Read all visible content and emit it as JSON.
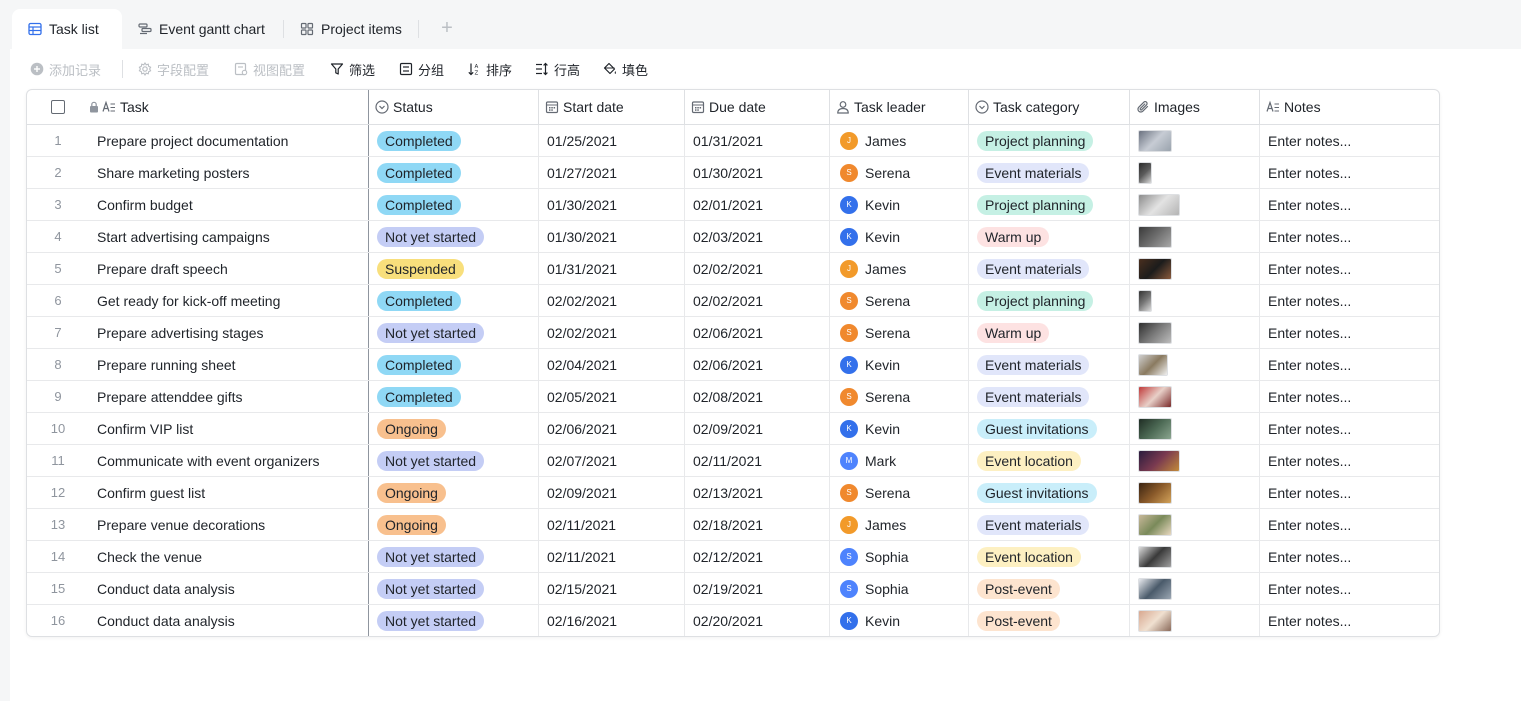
{
  "tabs": [
    {
      "label": "Task list",
      "icon": "table-icon",
      "active": true
    },
    {
      "label": "Event gantt chart",
      "icon": "gantt-icon",
      "active": false
    },
    {
      "label": "Project items",
      "icon": "grid-icon",
      "active": false
    }
  ],
  "add_tab_symbol": "+",
  "toolbar": {
    "add_record": "添加记录",
    "field_config": "字段配置",
    "view_config": "视图配置",
    "filter": "筛选",
    "group": "分组",
    "sort": "排序",
    "row_height": "行高",
    "fill": "填色"
  },
  "columns": {
    "task": "Task",
    "status": "Status",
    "start_date": "Start date",
    "due_date": "Due date",
    "task_leader": "Task leader",
    "task_category": "Task category",
    "images": "Images",
    "notes": "Notes"
  },
  "colors": {
    "status": {
      "Completed": "#8fd8f5",
      "Not yet started": "#c4cdf5",
      "Suspended": "#f8df7c",
      "Ongoing": "#f8c08e"
    },
    "category": {
      "Project planning": "#c5f0e4",
      "Event materials": "#e1e6fa",
      "Warm up": "#fde2e2",
      "Guest invitations": "#c9eefa",
      "Event location": "#fdf0c2",
      "Post-event": "#fde4cf"
    },
    "leader": {
      "James": "#f29a2a",
      "Serena": "#f0892e",
      "Kevin": "#3370eb",
      "Mark": "#4e83fd",
      "Sophia": "#4e83fd"
    }
  },
  "rows": [
    {
      "num": "1",
      "task": "Prepare project documentation",
      "status": "Completed",
      "start": "01/25/2021",
      "due": "01/31/2021",
      "leader": "James",
      "initial": "J",
      "category": "Project planning",
      "notes": "Enter notes..."
    },
    {
      "num": "2",
      "task": "Share marketing posters",
      "status": "Completed",
      "start": "01/27/2021",
      "due": "01/30/2021",
      "leader": "Serena",
      "initial": "S",
      "category": "Event materials",
      "notes": "Enter notes..."
    },
    {
      "num": "3",
      "task": "Confirm budget",
      "status": "Completed",
      "start": "01/30/2021",
      "due": "02/01/2021",
      "leader": "Kevin",
      "initial": "K",
      "category": "Project planning",
      "notes": "Enter notes..."
    },
    {
      "num": "4",
      "task": "Start advertising campaigns",
      "status": "Not yet started",
      "start": "01/30/2021",
      "due": "02/03/2021",
      "leader": "Kevin",
      "initial": "K",
      "category": "Warm up",
      "notes": "Enter notes..."
    },
    {
      "num": "5",
      "task": "Prepare draft speech",
      "status": "Suspended",
      "start": "01/31/2021",
      "due": "02/02/2021",
      "leader": "James",
      "initial": "J",
      "category": "Event materials",
      "notes": "Enter notes..."
    },
    {
      "num": "6",
      "task": "Get ready for kick-off meeting",
      "status": "Completed",
      "start": "02/02/2021",
      "due": "02/02/2021",
      "leader": "Serena",
      "initial": "S",
      "category": "Project planning",
      "notes": "Enter notes..."
    },
    {
      "num": "7",
      "task": "Prepare advertising stages",
      "status": "Not yet started",
      "start": "02/02/2021",
      "due": "02/06/2021",
      "leader": "Serena",
      "initial": "S",
      "category": "Warm up",
      "notes": "Enter notes..."
    },
    {
      "num": "8",
      "task": "Prepare running sheet",
      "status": "Completed",
      "start": "02/04/2021",
      "due": "02/06/2021",
      "leader": "Kevin",
      "initial": "K",
      "category": "Event materials",
      "notes": "Enter notes..."
    },
    {
      "num": "9",
      "task": "Prepare attenddee gifts",
      "status": "Completed",
      "start": "02/05/2021",
      "due": "02/08/2021",
      "leader": "Serena",
      "initial": "S",
      "category": "Event materials",
      "notes": "Enter notes..."
    },
    {
      "num": "10",
      "task": "Confirm VIP list",
      "status": "Ongoing",
      "start": "02/06/2021",
      "due": "02/09/2021",
      "leader": "Kevin",
      "initial": "K",
      "category": "Guest invitations",
      "notes": "Enter notes..."
    },
    {
      "num": "11",
      "task": "Communicate with event organizers",
      "status": "Not yet started",
      "start": "02/07/2021",
      "due": "02/11/2021",
      "leader": "Mark",
      "initial": "M",
      "category": "Event location",
      "notes": "Enter notes..."
    },
    {
      "num": "12",
      "task": "Confirm guest list",
      "status": "Ongoing",
      "start": "02/09/2021",
      "due": "02/13/2021",
      "leader": "Serena",
      "initial": "S",
      "category": "Guest invitations",
      "notes": "Enter notes..."
    },
    {
      "num": "13",
      "task": "Prepare venue decorations",
      "status": "Ongoing",
      "start": "02/11/2021",
      "due": "02/18/2021",
      "leader": "James",
      "initial": "J",
      "category": "Event materials",
      "notes": "Enter notes..."
    },
    {
      "num": "14",
      "task": "Check the venue",
      "status": "Not yet started",
      "start": "02/11/2021",
      "due": "02/12/2021",
      "leader": "Sophia",
      "initial": "S",
      "category": "Event location",
      "notes": "Enter notes..."
    },
    {
      "num": "15",
      "task": "Conduct data analysis",
      "status": "Not yet started",
      "start": "02/15/2021",
      "due": "02/19/2021",
      "leader": "Sophia",
      "initial": "S",
      "category": "Post-event",
      "notes": "Enter notes..."
    },
    {
      "num": "16",
      "task": "Conduct data analysis",
      "status": "Not yet started",
      "start": "02/16/2021",
      "due": "02/20/2021",
      "leader": "Kevin",
      "initial": "K",
      "category": "Post-event",
      "notes": "Enter notes..."
    }
  ]
}
